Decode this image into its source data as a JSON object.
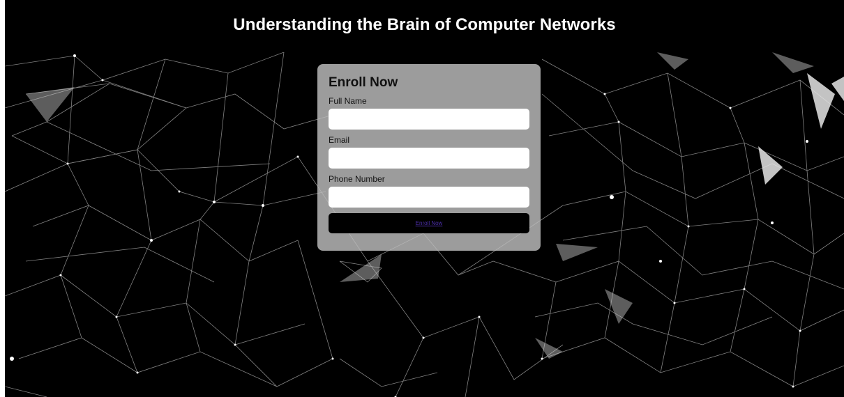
{
  "header": {
    "title": "Understanding the Brain of Computer Networks"
  },
  "form": {
    "title": "Enroll Now",
    "fields": [
      {
        "label": "Full Name",
        "value": "",
        "placeholder": ""
      },
      {
        "label": "Email",
        "value": "",
        "placeholder": ""
      },
      {
        "label": "Phone Number",
        "value": "",
        "placeholder": ""
      }
    ],
    "submit_label": "Enroll Now"
  },
  "colors": {
    "background": "#000000",
    "card": "#bebebe",
    "input": "#ffffff",
    "button": "#000000",
    "link": "#4b2ea8"
  }
}
